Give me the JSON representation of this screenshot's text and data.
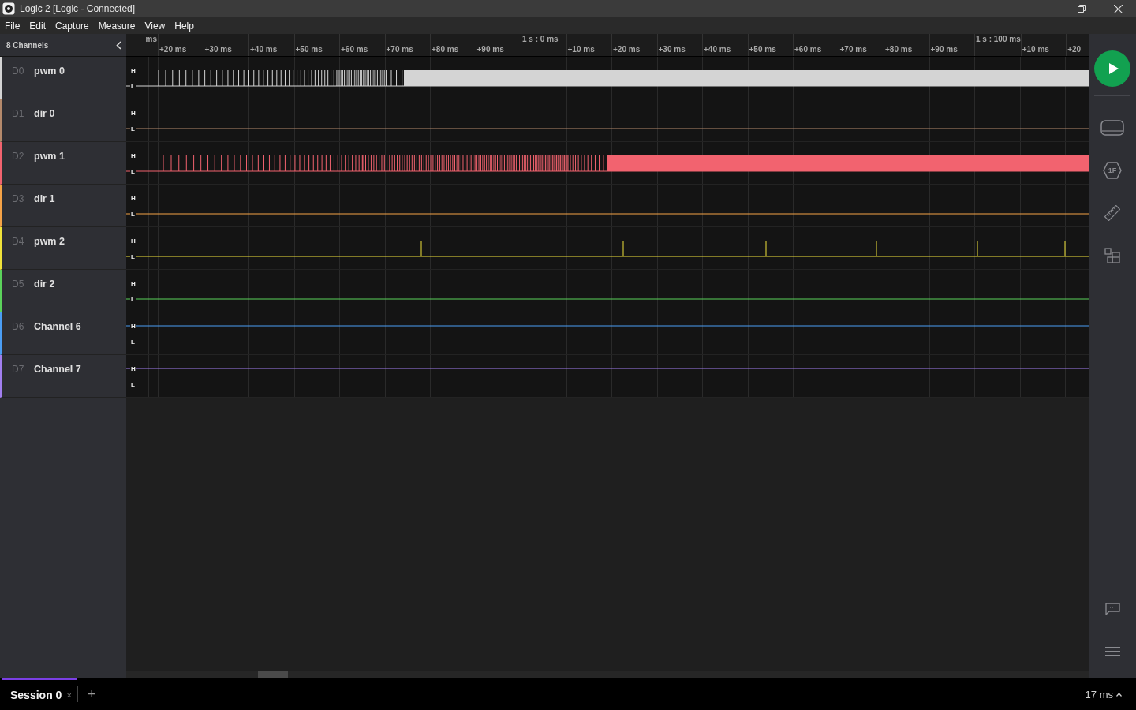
{
  "window": {
    "title": "Logic 2 [Logic - Connected]"
  },
  "menu": [
    "File",
    "Edit",
    "Capture",
    "Measure",
    "View",
    "Help"
  ],
  "sidebar": {
    "title": "8 Channels"
  },
  "ruler": {
    "ticks": [
      {
        "label": "ms"
      },
      {
        "label": "+20 ms"
      },
      {
        "label": "+30 ms"
      },
      {
        "label": "+40 ms"
      },
      {
        "label": "+50 ms"
      },
      {
        "label": "+60 ms"
      },
      {
        "label": "+70 ms"
      },
      {
        "label": "+80 ms"
      },
      {
        "label": "+90 ms"
      },
      {
        "major": "1 s : 0 ms"
      },
      {
        "label": "+10 ms"
      },
      {
        "label": "+20 ms"
      },
      {
        "label": "+30 ms"
      },
      {
        "label": "+40 ms"
      },
      {
        "label": "+50 ms"
      },
      {
        "label": "+60 ms"
      },
      {
        "label": "+70 ms"
      },
      {
        "label": "+80 ms"
      },
      {
        "label": "+90 ms"
      },
      {
        "major": "1 s : 100 ms"
      },
      {
        "label": "+10 ms"
      },
      {
        "label": "+20"
      }
    ]
  },
  "channels": [
    {
      "id": "D0",
      "name": "pwm 0",
      "color": "#d4d4d4",
      "kind": "ramp",
      "high": "H",
      "low": "L"
    },
    {
      "id": "D1",
      "name": "dir 0",
      "color": "#b58a6c",
      "kind": "low",
      "high": "H",
      "low": "L"
    },
    {
      "id": "D2",
      "name": "pwm 1",
      "color": "#f2636f",
      "kind": "dense",
      "high": "H",
      "low": "L"
    },
    {
      "id": "D3",
      "name": "dir 1",
      "color": "#f5a347",
      "kind": "low",
      "high": "H",
      "low": "L"
    },
    {
      "id": "D4",
      "name": "pwm 2",
      "color": "#f0e23a",
      "kind": "spikes",
      "high": "H",
      "low": "L"
    },
    {
      "id": "D5",
      "name": "dir 2",
      "color": "#5bd35b",
      "kind": "low",
      "high": "H",
      "low": "L"
    },
    {
      "id": "D6",
      "name": "Channel 6",
      "color": "#4b9ef5",
      "kind": "high",
      "high": "H",
      "low": "L"
    },
    {
      "id": "D7",
      "name": "Channel 7",
      "color": "#a27ff0",
      "kind": "high",
      "high": "H",
      "low": "L"
    }
  ],
  "sessions": [
    {
      "label": "Session 0",
      "selected": true,
      "close": "×"
    }
  ],
  "add_tab": "+",
  "toolbar": {
    "analyzers_badge": "1F"
  },
  "status": {
    "zoom": "17 ms"
  }
}
